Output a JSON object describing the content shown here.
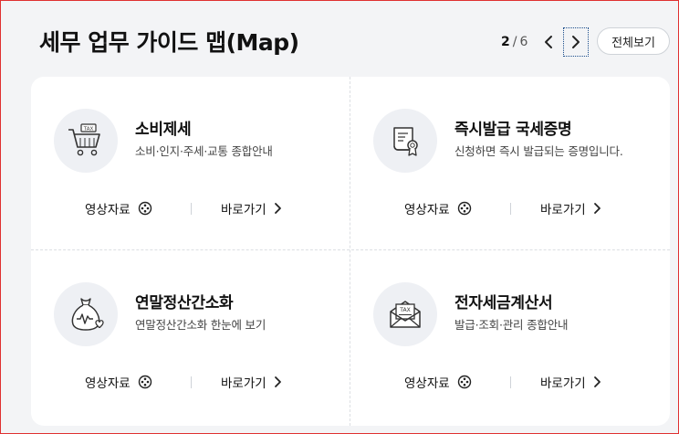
{
  "header": {
    "title": "세무 업무 가이드 맵(Map)",
    "pager": {
      "current": "2",
      "separator": "/",
      "total": "6"
    },
    "view_all_label": "전체보기"
  },
  "cards": [
    {
      "title": "소비제세",
      "desc": "소비·인지·주세·교통 종합안내",
      "icon": "shopping-cart-tax-icon",
      "video_label": "영상자료",
      "go_label": "바로가기"
    },
    {
      "title": "즉시발급 국세증명",
      "desc": "신청하면 즉시 발급되는 증명입니다.",
      "icon": "certificate-icon",
      "video_label": "영상자료",
      "go_label": "바로가기"
    },
    {
      "title": "연말정산간소화",
      "desc": "연말정산간소화 한눈에 보기",
      "icon": "money-bag-heart-icon",
      "video_label": "영상자료",
      "go_label": "바로가기"
    },
    {
      "title": "전자세금계산서",
      "desc": "발급·조회·관리 종합안내",
      "icon": "tax-envelope-icon",
      "video_label": "영상자료",
      "go_label": "바로가기"
    }
  ],
  "colors": {
    "accent": "#111111",
    "icon_bg": "#eef0f4",
    "divider": "#dcdfe3",
    "focus_outline": "#1c4e8c"
  }
}
